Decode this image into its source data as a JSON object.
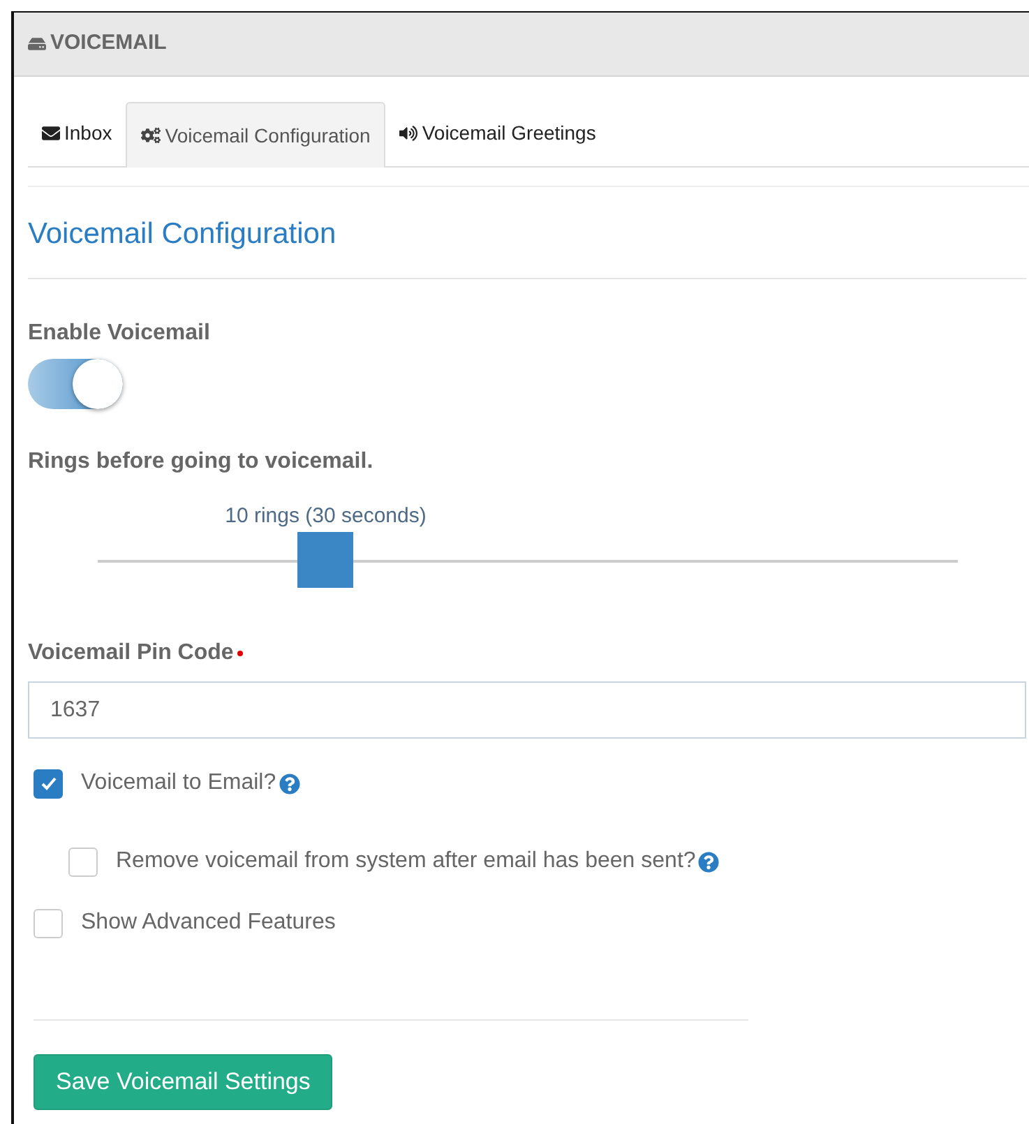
{
  "panel": {
    "title": "VOICEMAIL"
  },
  "tabs": [
    {
      "label": "Inbox",
      "kind": "inbox",
      "selected": false
    },
    {
      "label": "Voicemail Configuration",
      "kind": "configuration",
      "selected": true
    },
    {
      "label": "Voicemail Greetings",
      "kind": "greetings",
      "selected": false
    }
  ],
  "heading": "Voicemail Configuration",
  "enable_voicemail": {
    "label": "Enable Voicemail",
    "on": true
  },
  "rings": {
    "label": "Rings before going to voicemail.",
    "reading": "10 rings (30 seconds)",
    "level": 0.265
  },
  "pin_code": {
    "label": "Voicemail Pin Code",
    "required": true,
    "value": "1637"
  },
  "options": [
    {
      "label": "Voicemail to Email?",
      "checked": true,
      "help": true,
      "children": [
        {
          "label": "Remove voicemail from system after email has been sent?",
          "checked": false,
          "help": true
        }
      ]
    },
    {
      "label": "Show Advanced Features",
      "checked": false,
      "help": false
    }
  ],
  "save_button": "Save Voicemail Settings"
}
